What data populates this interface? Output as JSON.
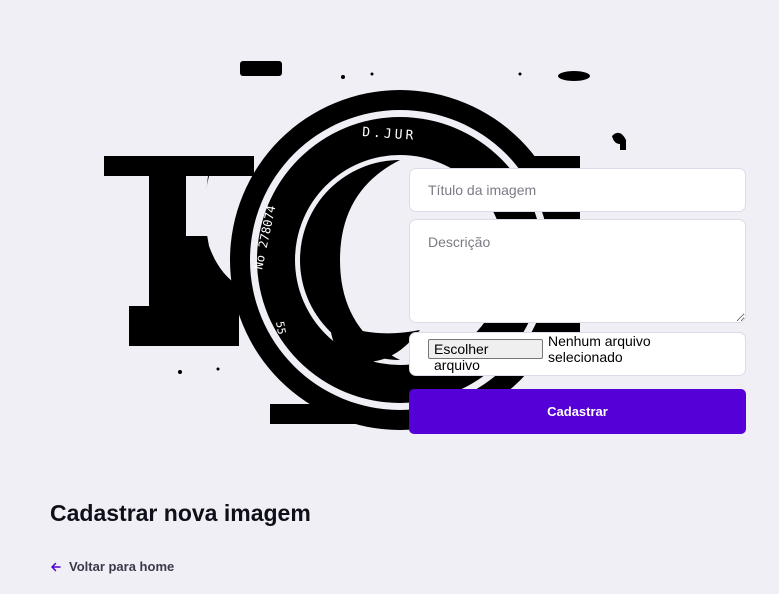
{
  "hero": {
    "icon": "vintage-camera-icon",
    "lens_ring_text": "No 278074",
    "lens_brand_text": "D.JUR",
    "lens_focal_text": "55"
  },
  "form": {
    "title_placeholder": "Título da imagem",
    "description_placeholder": "Descrição",
    "file_button_label": "Escolher arquivo",
    "file_status": "Nenhum arquivo selecionado",
    "submit_label": "Cadastrar"
  },
  "page": {
    "title": "Cadastrar nova imagem",
    "back_link_label": "Voltar para home"
  },
  "colors": {
    "background": "#efeff5",
    "accent": "#5500d6"
  },
  "icons": {
    "back": "arrow-left-icon"
  }
}
